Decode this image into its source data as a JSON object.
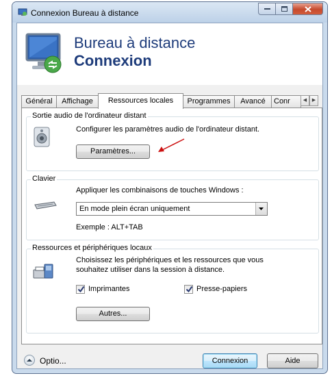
{
  "window": {
    "title": "Connexion Bureau à distance",
    "header_line1": "Bureau à distance",
    "header_line2": "Connexion"
  },
  "tabs": [
    {
      "label": "Général"
    },
    {
      "label": "Affichage"
    },
    {
      "label": "Ressources locales",
      "active": true
    },
    {
      "label": "Programmes"
    },
    {
      "label": "Avancé"
    },
    {
      "label": "Conr"
    }
  ],
  "audio": {
    "group_title": "Sortie audio de l'ordinateur distant",
    "description": "Configurer les paramètres audio de l'ordinateur distant.",
    "settings_button": "Paramètres..."
  },
  "keyboard": {
    "group_title": "Clavier",
    "description": "Appliquer les combinaisons de touches Windows :",
    "selected_option": "En mode plein écran uniquement",
    "example": "Exemple : ALT+TAB"
  },
  "resources": {
    "group_title": "Ressources et périphériques locaux",
    "description_line1": "Choisissez les périphériques et les ressources que vous",
    "description_line2": "souhaitez utiliser dans la session à distance.",
    "printers_label": "Imprimantes",
    "printers_checked": true,
    "clipboard_label": "Presse-papiers",
    "clipboard_checked": true,
    "more_button": "Autres..."
  },
  "footer": {
    "options_label": "Optio...",
    "connect_button": "Connexion",
    "help_button": "Aide"
  },
  "colors": {
    "header_text": "#1d3b7a",
    "annotation_arrow": "#cc1111"
  }
}
